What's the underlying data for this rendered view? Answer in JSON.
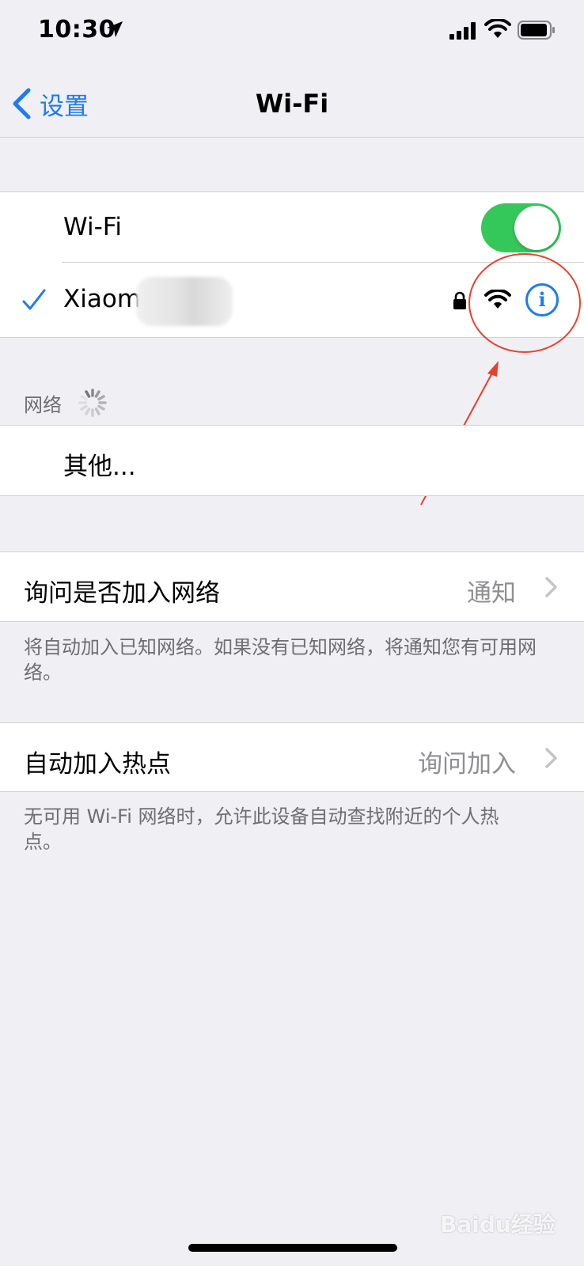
{
  "status_bar": {
    "time": "10:30"
  },
  "nav": {
    "back_label": "设置",
    "title": "Wi-Fi"
  },
  "wifi": {
    "label": "Wi-Fi",
    "enabled": true,
    "connected_network": "Xiaom",
    "toggle_color": "#34c759"
  },
  "networks": {
    "header": "网络",
    "other_label": "其他..."
  },
  "ask_join": {
    "label": "询问是否加入网络",
    "value": "通知",
    "footer": "将自动加入已知网络。如果没有已知网络，将通知您有可用网络。"
  },
  "auto_hotspot": {
    "label": "自动加入热点",
    "value": "询问加入",
    "footer": "无可用 Wi-Fi 网络时，允许此设备自动查找附近的个人热点。"
  },
  "watermark": "Baidu经验",
  "colors": {
    "accent": "#1c7cf0",
    "annotation": "#e8402c"
  }
}
